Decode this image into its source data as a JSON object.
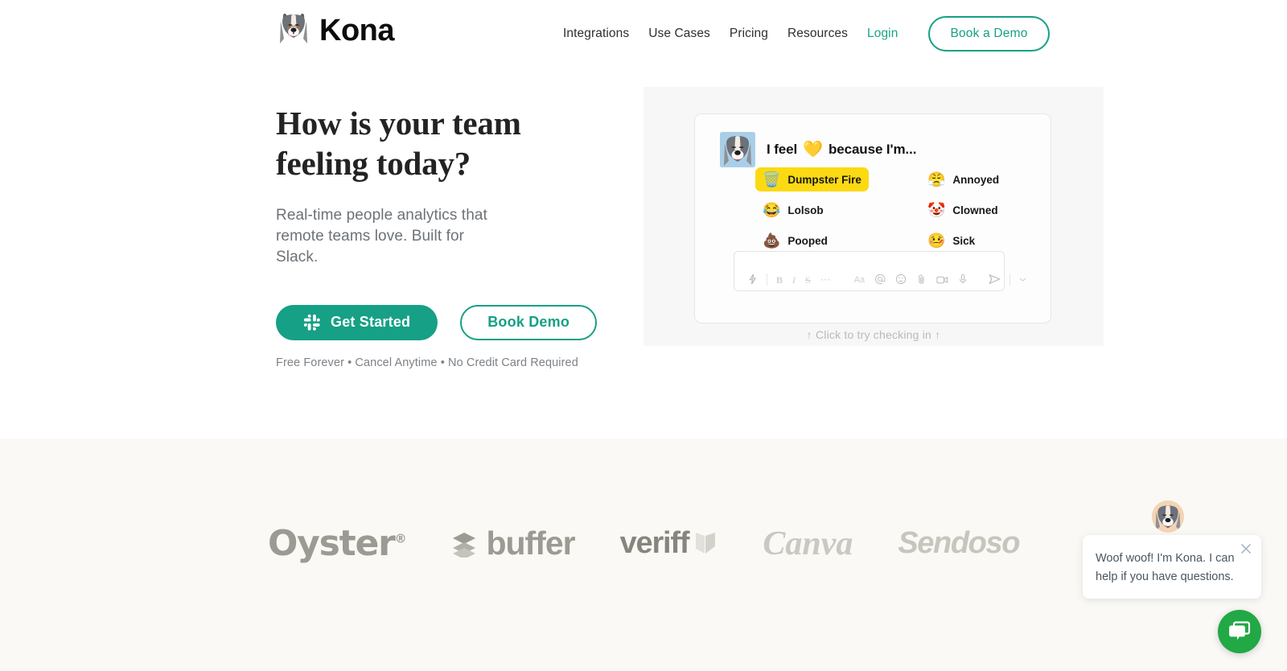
{
  "header": {
    "brand_name": "Kona",
    "brand_logo_icon": "kona-dog-logo-icon",
    "nav": [
      {
        "label": "Integrations",
        "kind": "link"
      },
      {
        "label": "Use Cases",
        "kind": "link"
      },
      {
        "label": "Pricing",
        "kind": "link"
      },
      {
        "label": "Resources",
        "kind": "link"
      },
      {
        "label": "Login",
        "kind": "link-accent"
      }
    ],
    "cta_label": "Book a Demo"
  },
  "hero": {
    "title_line1": "How is your team",
    "title_line2": "feeling today?",
    "subtitle": "Real-time people analytics that remote teams love. Built for Slack.",
    "primary_cta": {
      "label": "Get Started",
      "icon": "slack-icon"
    },
    "secondary_cta": {
      "label": "Book Demo"
    },
    "note": "Free Forever • Cancel Anytime • No Credit Card Required",
    "caption": "↑ Click to try checking in ↑"
  },
  "slack_card": {
    "avatar_icon": "kona-dog-avatar-icon",
    "prompt_before": "I feel",
    "prompt_emoji": "💛",
    "prompt_after": "because I'm...",
    "moods": [
      {
        "label": "Dumpster Fire",
        "emoji": "🗑️",
        "selected": true
      },
      {
        "label": "Annoyed",
        "emoji": "😤",
        "selected": false
      },
      {
        "label": "Lolsob",
        "emoji": "😂",
        "selected": false
      },
      {
        "label": "Clowned",
        "emoji": "🤡",
        "selected": false
      },
      {
        "label": "Pooped",
        "emoji": "💩",
        "selected": false
      },
      {
        "label": "Sick",
        "emoji": "🤒",
        "selected": false
      }
    ],
    "composer_placeholder": "",
    "composer_tools": [
      "lightning-icon",
      "bold-icon",
      "italic-icon",
      "strikethrough-icon",
      "more-icon",
      "text-format-icon",
      "mention-icon",
      "emoji-icon",
      "attachment-icon",
      "video-icon",
      "microphone-icon",
      "send-icon",
      "chevron-down-icon"
    ]
  },
  "logos_section": {
    "logos": [
      {
        "name": "Oyster",
        "id": "oyster-logo"
      },
      {
        "name": "buffer",
        "id": "buffer-logo"
      },
      {
        "name": "veriff",
        "id": "veriff-logo"
      },
      {
        "name": "Canva",
        "id": "canva-logo"
      },
      {
        "name": "Sendoso",
        "id": "sendoso-logo"
      }
    ]
  },
  "chat_widget": {
    "message": "Woof woof! I'm Kona. I can help if you have questions.",
    "avatar_icon": "kona-dog-avatar-icon",
    "close_icon": "close-icon",
    "fab_icon": "chat-bubble-icon"
  },
  "colors": {
    "accent_teal": "#16a085",
    "accent_teal_link": "#19a389",
    "selected_yellow": "#fbd913",
    "section_cream": "#faf9f5",
    "chat_green": "#22a845",
    "panel_gray": "#f7f7f7"
  }
}
